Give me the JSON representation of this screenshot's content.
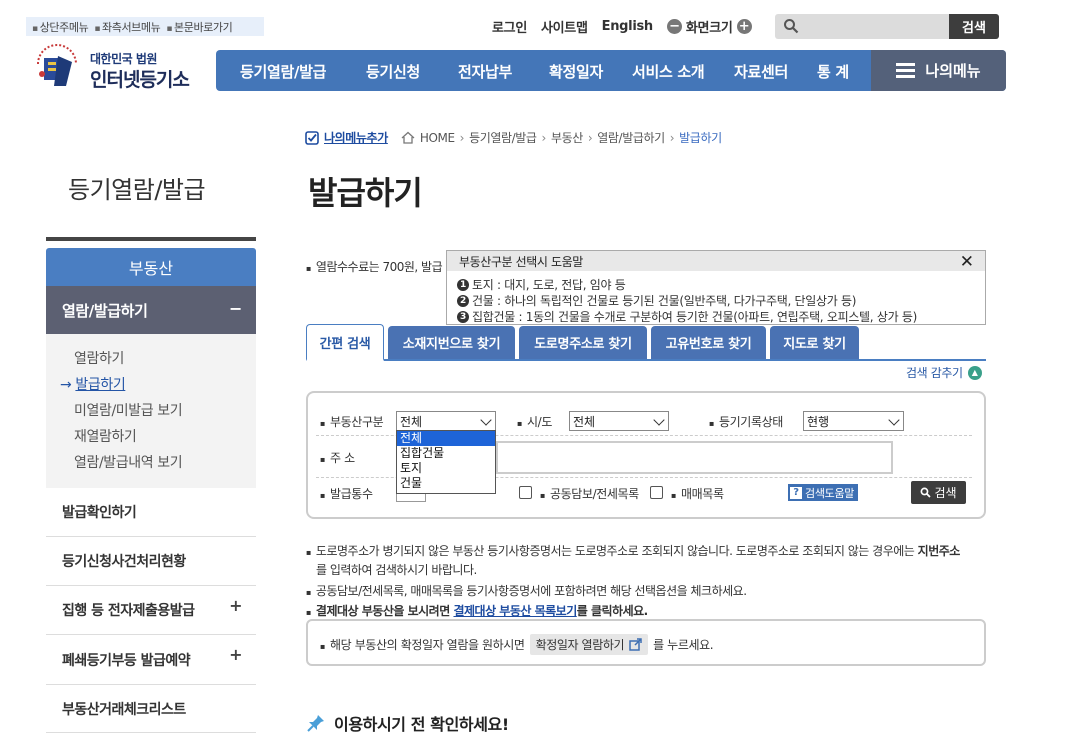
{
  "skip_links": [
    "상단주메뉴",
    "좌측서브메뉴",
    "본문바로가기"
  ],
  "util": {
    "login": "로그인",
    "sitemap": "사이트맵",
    "english": "English",
    "zoom_label": "화면크기",
    "zoom_out": "−",
    "zoom_in": "+"
  },
  "search": {
    "placeholder": "",
    "button": "검색"
  },
  "logo": {
    "line1": "대한민국 법원",
    "line2": "인터넷등기소"
  },
  "gnb": {
    "items": [
      "등기열람/발급",
      "등기신청",
      "전자납부",
      "확정일자",
      "서비스 소개",
      "자료센터",
      "통 계"
    ],
    "my_menu": "나의메뉴"
  },
  "breadcrumb": {
    "add_my": "나의메뉴추가",
    "items": [
      "HOME",
      "등기열람/발급",
      "부동산",
      "열람/발급하기",
      "발급하기"
    ]
  },
  "page_title": "발급하기",
  "lnb": {
    "title": "등기열람/발급",
    "dep1": "부동산",
    "dep2": "열람/발급하기",
    "dep2_toggle": "−",
    "sub": [
      "열람하기",
      "발급하기",
      "미열람/미발급 보기",
      "재열람하기",
      "열람/발급내역 보기"
    ],
    "sub_active_marker": "→",
    "items": [
      {
        "label": "발급확인하기",
        "toggle": ""
      },
      {
        "label": "등기신청사건처리현황",
        "toggle": ""
      },
      {
        "label": "집행 등 전자제출용발급",
        "toggle": "+"
      },
      {
        "label": "폐쇄등기부등 발급예약",
        "toggle": "+"
      },
      {
        "label": "부동산거래체크리스트",
        "toggle": ""
      }
    ]
  },
  "fee_notice": "열람수수료는 700원, 발급",
  "tooltip": {
    "title": "부동산구분 선택시 도움말",
    "close": "✕",
    "lines": [
      {
        "num": "1",
        "text": "토지 : 대지, 도로, 전답, 임야 등"
      },
      {
        "num": "2",
        "text": "건물 : 하나의 독립적인 건물로 등기된 건물(일반주택, 다가구주택, 단일상가 등)"
      },
      {
        "num": "3",
        "text": "집합건물 : 1동의 건물을 수개로 구분하여 등기한 건물(아파트, 연립주택, 오피스텔, 상가 등)"
      }
    ]
  },
  "tabs": [
    "간편 검색",
    "소재지번으로 찾기",
    "도로명주소로 찾기",
    "고유번호로 찾기",
    "지도로 찾기"
  ],
  "fold_label": "검색 감추기",
  "form": {
    "type_label": "부동산구분",
    "type_value": "전체",
    "type_options": [
      "전체",
      "집합건물",
      "토지",
      "건물"
    ],
    "sido_label": "시/도",
    "sido_value": "전체",
    "status_label": "등기기록상태",
    "status_value": "현행",
    "addr_label": "주 소",
    "qty_label": "발급통수",
    "cb1": "공동담보/전세목록",
    "cb2": "매매목록",
    "help_btn": "검색도움말",
    "search_btn": "검색"
  },
  "notes": {
    "n1a": "도로명주소가 병기되지 않은 부동산 등기사항증명서는 도로명주소로 조회되지 않습니다. 도로명주소로 조회되지 않는 경우에는",
    "n1b": "지번주소",
    "n1c": "를 입력하여 검색하시기 바랍니다.",
    "n2": "공동담보/전세목록, 매매목록을 등기사항증명서에 포함하려면 해당 선택옵션을 체크하세요.",
    "n3a": "결제대상 부동산을 보시려면",
    "n3link": "결제대상 부동산 목록보기",
    "n3b": "를 클릭하세요."
  },
  "confirm": {
    "pre": "해당 부동산의 확정일자 열람을 원하시면",
    "btn": "확정일자 열람하기",
    "post": "를 누르세요."
  },
  "check_title": "이용하시기 전 확인하세요!"
}
